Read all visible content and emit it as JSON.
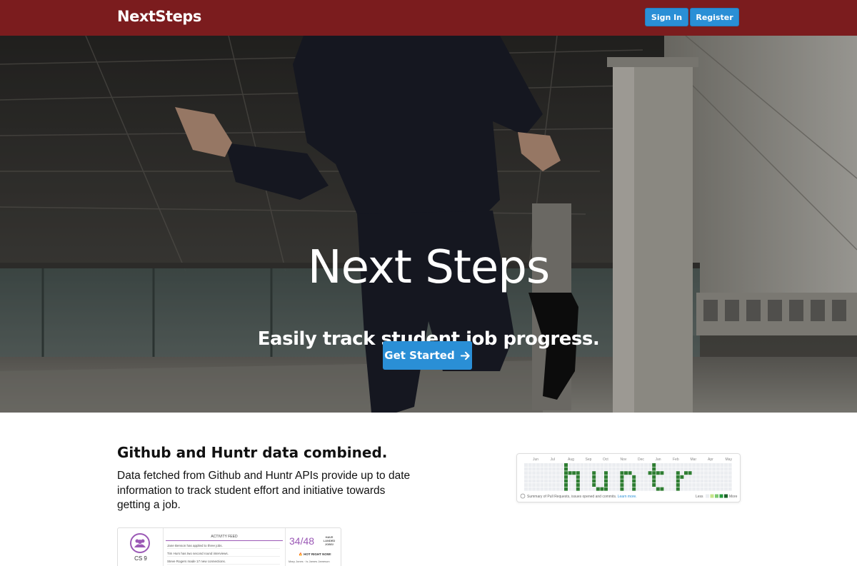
{
  "navbar": {
    "brand": "NextSteps",
    "sign_in_label": "Sign In",
    "register_label": "Register"
  },
  "hero": {
    "title": "Next Steps",
    "subtitle": "Easily track student job progress.",
    "cta_label": "Get Started",
    "cta_icon": "arrow-right-icon"
  },
  "features": {
    "title": "Github and Huntr data combined.",
    "description": "Data fetched from Github and Huntr APIs provide up to date information to track student effort and initiative towards getting a job."
  },
  "huntr_card": {
    "months": [
      "Jun",
      "Jul",
      "Aug",
      "Sep",
      "Oct",
      "Nov",
      "Dec",
      "Jan",
      "Feb",
      "Mar",
      "Apr",
      "May"
    ],
    "contribution_word": "huntr",
    "summary": "Summary of Pull Requests, issues opened and commits.",
    "learn_more": "Learn more.",
    "legend_less": "Less",
    "legend_more": "More"
  },
  "dashboard_card": {
    "class_label": "CS 9",
    "feed_title": "ACTIVITY FEED",
    "feed_items": [
      "Jane Benson has applied to three jobs.",
      "Tim Hurs has two second round interviews.",
      "Steve Rogers made 17 new connections."
    ],
    "ratio": "34/48",
    "landed_label": "HAVE LANDED JOBS!",
    "hot_label": "🔥 HOT RIGHT NOW!",
    "hot_names": "Mary Jones · Is James Jameson"
  },
  "colors": {
    "navbar": "#7b1c1e",
    "primary_button": "#2a8fd6",
    "accent_purple": "#9b59b6",
    "contribution_green": "#2e7d32"
  }
}
